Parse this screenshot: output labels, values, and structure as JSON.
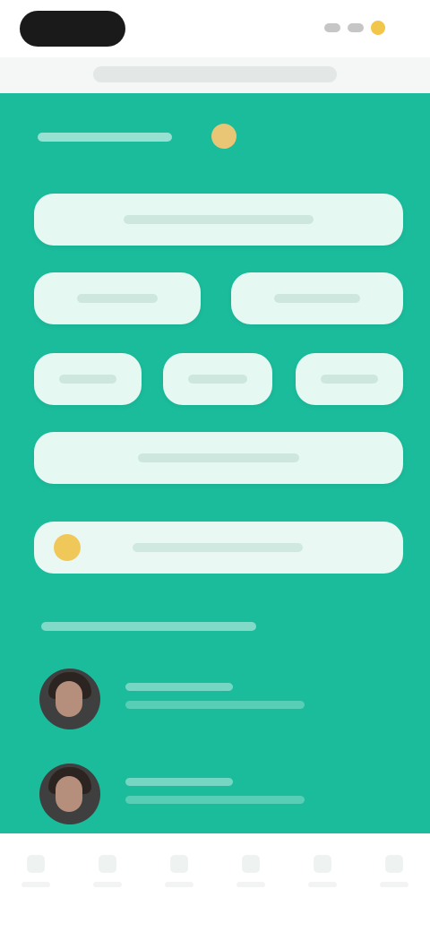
{
  "status_bar": {
    "time": "",
    "icons": [
      "signal-icon",
      "wifi-icon",
      "battery-icon"
    ]
  },
  "address_bar": {
    "url": ""
  },
  "panel": {
    "accent_color": "#1abc9c",
    "button_color": "#e6f8f2",
    "header": {
      "title": "",
      "badge_icon": "badge-icon"
    },
    "buttons": [
      {
        "label": ""
      },
      {
        "label": ""
      },
      {
        "label": ""
      },
      {
        "label": ""
      },
      {
        "label": ""
      },
      {
        "label": ""
      },
      {
        "label": ""
      }
    ],
    "promo": {
      "icon": "coin-icon",
      "label": ""
    },
    "section_title": "",
    "people": [
      {
        "name": "",
        "subtitle": ""
      },
      {
        "name": "",
        "subtitle": ""
      }
    ]
  },
  "bottom_nav": {
    "items": [
      {
        "icon": "nav-icon",
        "label": ""
      },
      {
        "icon": "nav-icon",
        "label": ""
      },
      {
        "icon": "nav-icon",
        "label": ""
      },
      {
        "icon": "nav-icon",
        "label": ""
      },
      {
        "icon": "nav-icon",
        "label": ""
      },
      {
        "icon": "nav-icon",
        "label": ""
      }
    ]
  }
}
